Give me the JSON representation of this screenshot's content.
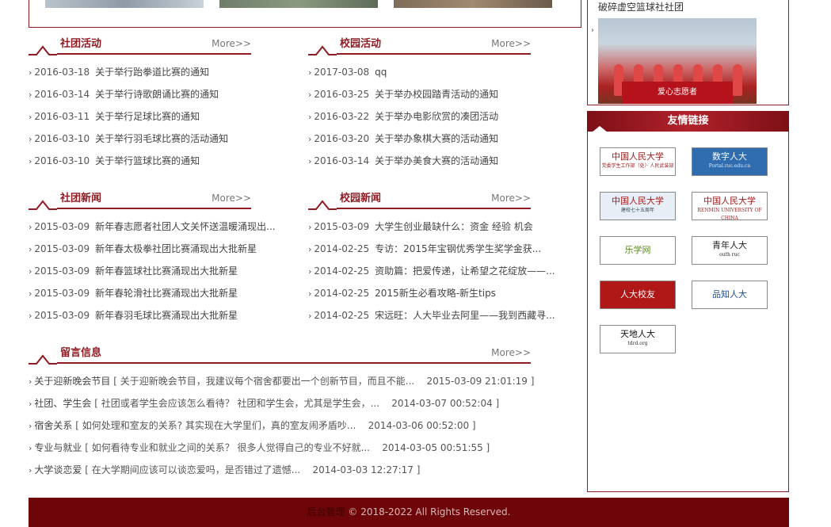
{
  "sidebar": {
    "club_name": "破碎虚空篮球社社团",
    "photo_banner": "爱心志愿者",
    "links_title": "友情链接",
    "links": [
      {
        "line1": "中国人民大学",
        "line2": "党委学生工作部（处）· 人民武装部",
        "icon": "ruc-seal-icon"
      },
      {
        "line1": "数字人大",
        "line2": "Portal.ruc.edu.cn",
        "icon": "digital-ruc-logo"
      },
      {
        "line1": "中国人民大学",
        "line2": "建校七十五周年",
        "icon": "ruc-75-anniversary-logo"
      },
      {
        "line1": "中国人民大学",
        "line2": "RENMIN UNIVERSITY OF CHINA",
        "icon": "ruc-seal-icon"
      },
      {
        "line1": "乐学网",
        "line2": "",
        "icon": "lexue-star-icon"
      },
      {
        "line1": "青年人大",
        "line2": "outh ruc",
        "icon": "youth-ruc-leaf-icon"
      },
      {
        "line1": "人大校友",
        "line2": "",
        "icon": "ruc-alumni-logo"
      },
      {
        "line1": "品知人大",
        "line2": "",
        "icon": "pinzhi-ruc-logo"
      },
      {
        "line1": "天地人大",
        "line2": "tdrd.org",
        "icon": "tdrd-logo"
      }
    ]
  },
  "sections": {
    "club_activities": {
      "title": "社团活动",
      "more": "More>>",
      "items": [
        {
          "date": "2016-03-18",
          "text": "关于举行跆拳道比赛的通知"
        },
        {
          "date": "2016-03-14",
          "text": "关于举行诗歌朗诵比赛的通知"
        },
        {
          "date": "2016-03-11",
          "text": "关于举行足球比赛的通知"
        },
        {
          "date": "2016-03-10",
          "text": "关于举行羽毛球比赛的活动通知"
        },
        {
          "date": "2016-03-10",
          "text": "关于举行篮球比赛的通知"
        }
      ]
    },
    "campus_activities": {
      "title": "校园活动",
      "more": "More>>",
      "items": [
        {
          "date": "2017-03-08",
          "text": "qq"
        },
        {
          "date": "2016-03-25",
          "text": "关于举办校园踏青活动的通知"
        },
        {
          "date": "2016-03-22",
          "text": "关于举办电影欣赏的凑团活动"
        },
        {
          "date": "2016-03-20",
          "text": "关于举办象棋大赛的活动通知"
        },
        {
          "date": "2016-03-14",
          "text": "关于举办美食大赛的活动通知"
        }
      ]
    },
    "club_news": {
      "title": "社团新闻",
      "more": "More>>",
      "items": [
        {
          "date": "2015-03-09",
          "text": "新年春志愿者社团人文关怀送温暖涌现出..."
        },
        {
          "date": "2015-03-09",
          "text": "新年春太极拳社团比赛涌现出大批新星"
        },
        {
          "date": "2015-03-09",
          "text": "新年春篮球社比赛涌现出大批新星"
        },
        {
          "date": "2015-03-09",
          "text": "新年春轮滑社比赛涌现出大批新星"
        },
        {
          "date": "2015-03-09",
          "text": "新年春羽毛球比赛涌现出大批新星"
        }
      ]
    },
    "campus_news": {
      "title": "校园新闻",
      "more": "More>>",
      "items": [
        {
          "date": "2015-03-09",
          "text": "大学生创业最缺什么：资金 经验 机会"
        },
        {
          "date": "2014-02-25",
          "text": "专访：2015年宝钢优秀学生奖学金获..."
        },
        {
          "date": "2014-02-25",
          "text": "资助篇：把爱传递，让希望之花绽放——..."
        },
        {
          "date": "2014-02-25",
          "text": "2015新生必看攻略-新生tips"
        },
        {
          "date": "2014-02-25",
          "text": "宋远旺：人大毕业去阿里——我到西藏寻..."
        }
      ]
    },
    "messages": {
      "title": "留言信息",
      "more": "More>>",
      "items": [
        {
          "subject": "关于迎新晚会节目",
          "excerpt": "[ 关于迎新晚会节目，我建议每个宿舍都要出一个创新节目，而且不能...",
          "time": "2015-03-09 21:01:19 ]"
        },
        {
          "subject": "社团、学生会",
          "excerpt": "[ 社团或者学生会应该怎么看待？ 社团和学生会，尤其是学生会，...",
          "time": "2014-03-07 00:52:04 ]"
        },
        {
          "subject": "宿舍关系",
          "excerpt": "[ 如何处理和室友的关系? 其实现在大学里们，真的室友闹矛盾吵...",
          "time": "2014-03-06 00:52:00 ]"
        },
        {
          "subject": "专业与就业",
          "excerpt": "[ 如何看待专业和就业之间的关系？ 很多人觉得自己的专业不好就...",
          "time": "2014-03-05 00:51:55 ]"
        },
        {
          "subject": "大学谈恋爱",
          "excerpt": "[ 在大学期间应该可以谈恋爱吗，是否错过了遗憾...",
          "time": "2014-03-03 12:27:17 ]"
        }
      ]
    }
  },
  "footer": {
    "admin_link": "后台管理",
    "copyright": " © 2018-2022 All Rights Reserved."
  },
  "colors": {
    "accent": "#8f1c23",
    "footer_bg": "#6e0508"
  }
}
